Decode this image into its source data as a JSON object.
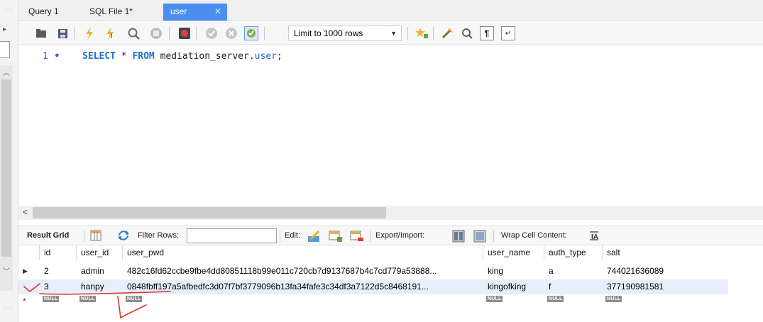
{
  "tabs": [
    {
      "label": "Query 1"
    },
    {
      "label": "SQL File 1*"
    },
    {
      "label": "user",
      "close": "✕"
    }
  ],
  "toolbar": {
    "limit_label": "Limit to 1000 rows",
    "icons": [
      "open-folder-icon",
      "save-icon",
      "execute-icon",
      "execute-current-icon",
      "explain-icon",
      "stop-icon",
      "toggle-error-icon",
      "commit-icon",
      "rollback-icon",
      "autocommit-icon",
      "limit-select",
      "bookmark-icon",
      "beautify-icon",
      "find-icon",
      "invisible-chars-icon",
      "wrap-icon"
    ]
  },
  "editor": {
    "line_number": "1",
    "sql": {
      "kw_select": "SELECT",
      "star": " * ",
      "kw_from": "FROM",
      "schema": " mediation_server.",
      "table": "user",
      "semicolon": ";"
    }
  },
  "result_toolbar": {
    "result_grid": "Result Grid",
    "filter_rows": "Filter Rows:",
    "edit": "Edit:",
    "export_import": "Export/Import:",
    "wrap_cell": "Wrap Cell Content:"
  },
  "grid": {
    "columns": [
      "id",
      "user_id",
      "user_pwd",
      "user_name",
      "auth_type",
      "salt"
    ],
    "rows": [
      [
        "2",
        "admin",
        "482c16fd62ccbe9fbe4dd80851118b99e011c720cb7d9137687b4c7cd779a53888...",
        "king",
        "a",
        "744021636089"
      ],
      [
        "3",
        "hanpy",
        "0848fbff197a5afbedfc3d07f7bf3779096b13fa34fafe3c34df3a7122d5c8468191...",
        "kingofking",
        "f",
        "377190981581"
      ]
    ],
    "null_label": "NULL",
    "new_row_marker": "*"
  },
  "colors": {
    "active_tab": "#4a8ef0",
    "keyword": "#1f6fce",
    "selected_row": "#e8eefc",
    "annotation": "#e0312b"
  }
}
